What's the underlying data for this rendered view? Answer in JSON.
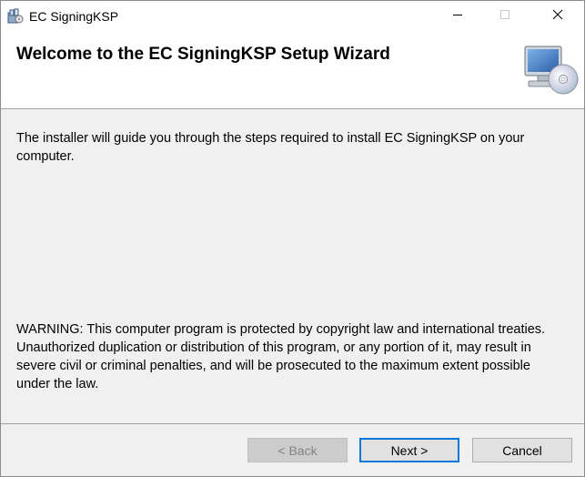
{
  "window": {
    "title": "EC SigningKSP",
    "icon": "installer-package-icon"
  },
  "controls": {
    "minimize_icon": "minimize-icon",
    "maximize_icon": "maximize-icon",
    "close_icon": "close-icon"
  },
  "header": {
    "title": "Welcome to the EC SigningKSP Setup Wizard",
    "icon": "computer-cd-icon"
  },
  "content": {
    "intro": "The installer will guide you through the steps required to install EC SigningKSP on your computer.",
    "warning": "WARNING: This computer program is protected by copyright law and international treaties. Unauthorized duplication or distribution of this program, or any portion of it, may result in severe civil or criminal penalties, and will be prosecuted to the maximum extent possible under the law."
  },
  "buttons": {
    "back": "< Back",
    "next": "Next >",
    "cancel": "Cancel"
  },
  "colors": {
    "focus_border": "#0078d7",
    "dialog_background": "#f0f0f0",
    "disabled_text": "#838383"
  }
}
